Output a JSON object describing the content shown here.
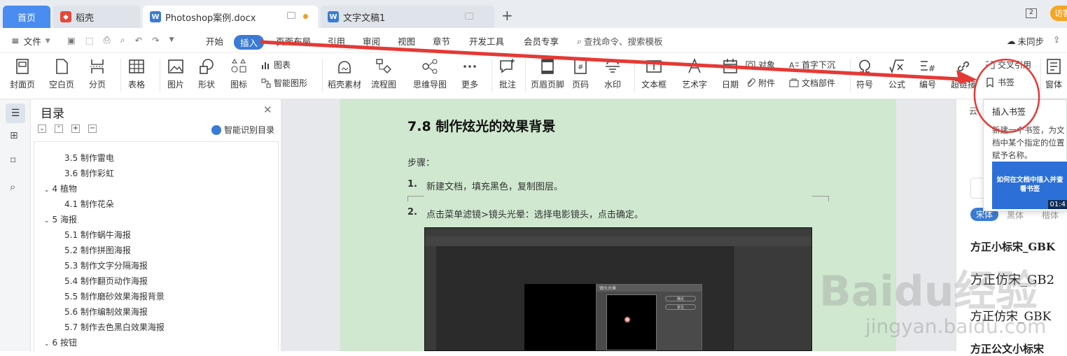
{
  "tabs": [
    {
      "label": "首页",
      "active": false
    },
    {
      "label": "稻壳",
      "active": false
    },
    {
      "label": "Photoshop案例.docx",
      "active": true
    },
    {
      "label": "文字文稿1",
      "active": false
    }
  ],
  "tabbar_right": {
    "window_count": "2",
    "visitor_label": "访客"
  },
  "menu": {
    "file": "文件",
    "items": [
      "开始",
      "插入",
      "页面布局",
      "引用",
      "审阅",
      "视图",
      "章节",
      "开发工具",
      "会员专享"
    ],
    "active": "插入",
    "search_placeholder": "查找命令、搜索模板",
    "sync_label": "未同步"
  },
  "ribbon": {
    "cover": "封面页",
    "blank": "空白页",
    "page_break": "分页",
    "table": "表格",
    "picture": "图片",
    "shape": "形状",
    "icon": "图标",
    "chart": "图表",
    "smart_graphic": "智能图形",
    "docer_material": "稻壳素材",
    "flowchart": "流程图",
    "mindmap": "思维导图",
    "more": "更多",
    "comment": "批注",
    "header_footer": "页眉页脚",
    "page_number": "页码",
    "watermark": "水印",
    "textbox": "文本框",
    "wordart": "艺术字",
    "date": "日期",
    "object": "对象",
    "attachment": "附件",
    "dropcap": "首字下沉",
    "doc_parts": "文档部件",
    "symbol": "符号",
    "formula": "公式",
    "numbering": "编号",
    "hyperlink": "超链接",
    "cross_ref": "交叉引用",
    "bookmark": "书签",
    "window": "窗体"
  },
  "toc": {
    "title": "目录",
    "smart_label": "智能识别目录",
    "items": [
      {
        "text": "3.5 制作雷电",
        "level": 2
      },
      {
        "text": "3.6 制作彩虹",
        "level": 2
      },
      {
        "text": "4 植物",
        "level": 1
      },
      {
        "text": "4.1 制作花朵",
        "level": 2
      },
      {
        "text": "5 海报",
        "level": 1
      },
      {
        "text": "5.1 制作蜗牛海报",
        "level": 2
      },
      {
        "text": "5.2 制作拼图海报",
        "level": 2
      },
      {
        "text": "5.3 制作文字分隔海报",
        "level": 2
      },
      {
        "text": "5.4 制作翻页动作海报",
        "level": 2
      },
      {
        "text": "5.5 制作磨砂效果海报背景",
        "level": 2
      },
      {
        "text": "5.6 制作编制效果海报",
        "level": 2
      },
      {
        "text": "5.7 制作去色黑白效果海报",
        "level": 2
      },
      {
        "text": "6 按钮",
        "level": 1
      }
    ]
  },
  "document": {
    "heading": "7.8 制作炫光的效果背景",
    "steps_label": "步骤：",
    "step1_num": "1.",
    "step1": "新建文档，填充黑色，复制图层。",
    "step2_num": "2.",
    "step2": "点击菜单滤镜>镜头光晕：选择电影镜头，点击确定。",
    "screenshot_dialog_title": "镜头光晕",
    "screenshot_ok": "确定",
    "screenshot_cancel": "复位"
  },
  "tooltip": {
    "title": "插入书签",
    "desc": "新建一个书签，为文档中某个指定的位置赋予名称。",
    "video_title": "如何在文档中插入并查看书签",
    "video_time": "01:4"
  },
  "right_panel": {
    "header": "云",
    "tab_active": "宋体",
    "tab2": "黑体",
    "tab3": "楷体",
    "fonts": [
      "方正小标宋_GBK",
      "方正仿宋_GB2",
      "方正仿宋_GBK",
      "方正公文小标宋"
    ]
  },
  "watermark": {
    "brand": "Baidu经验",
    "url": "jingyan.baidu.com"
  },
  "colors": {
    "accent": "#3a7bd5",
    "page_bg": "#cfe8cf",
    "annotation": "#e53935"
  }
}
